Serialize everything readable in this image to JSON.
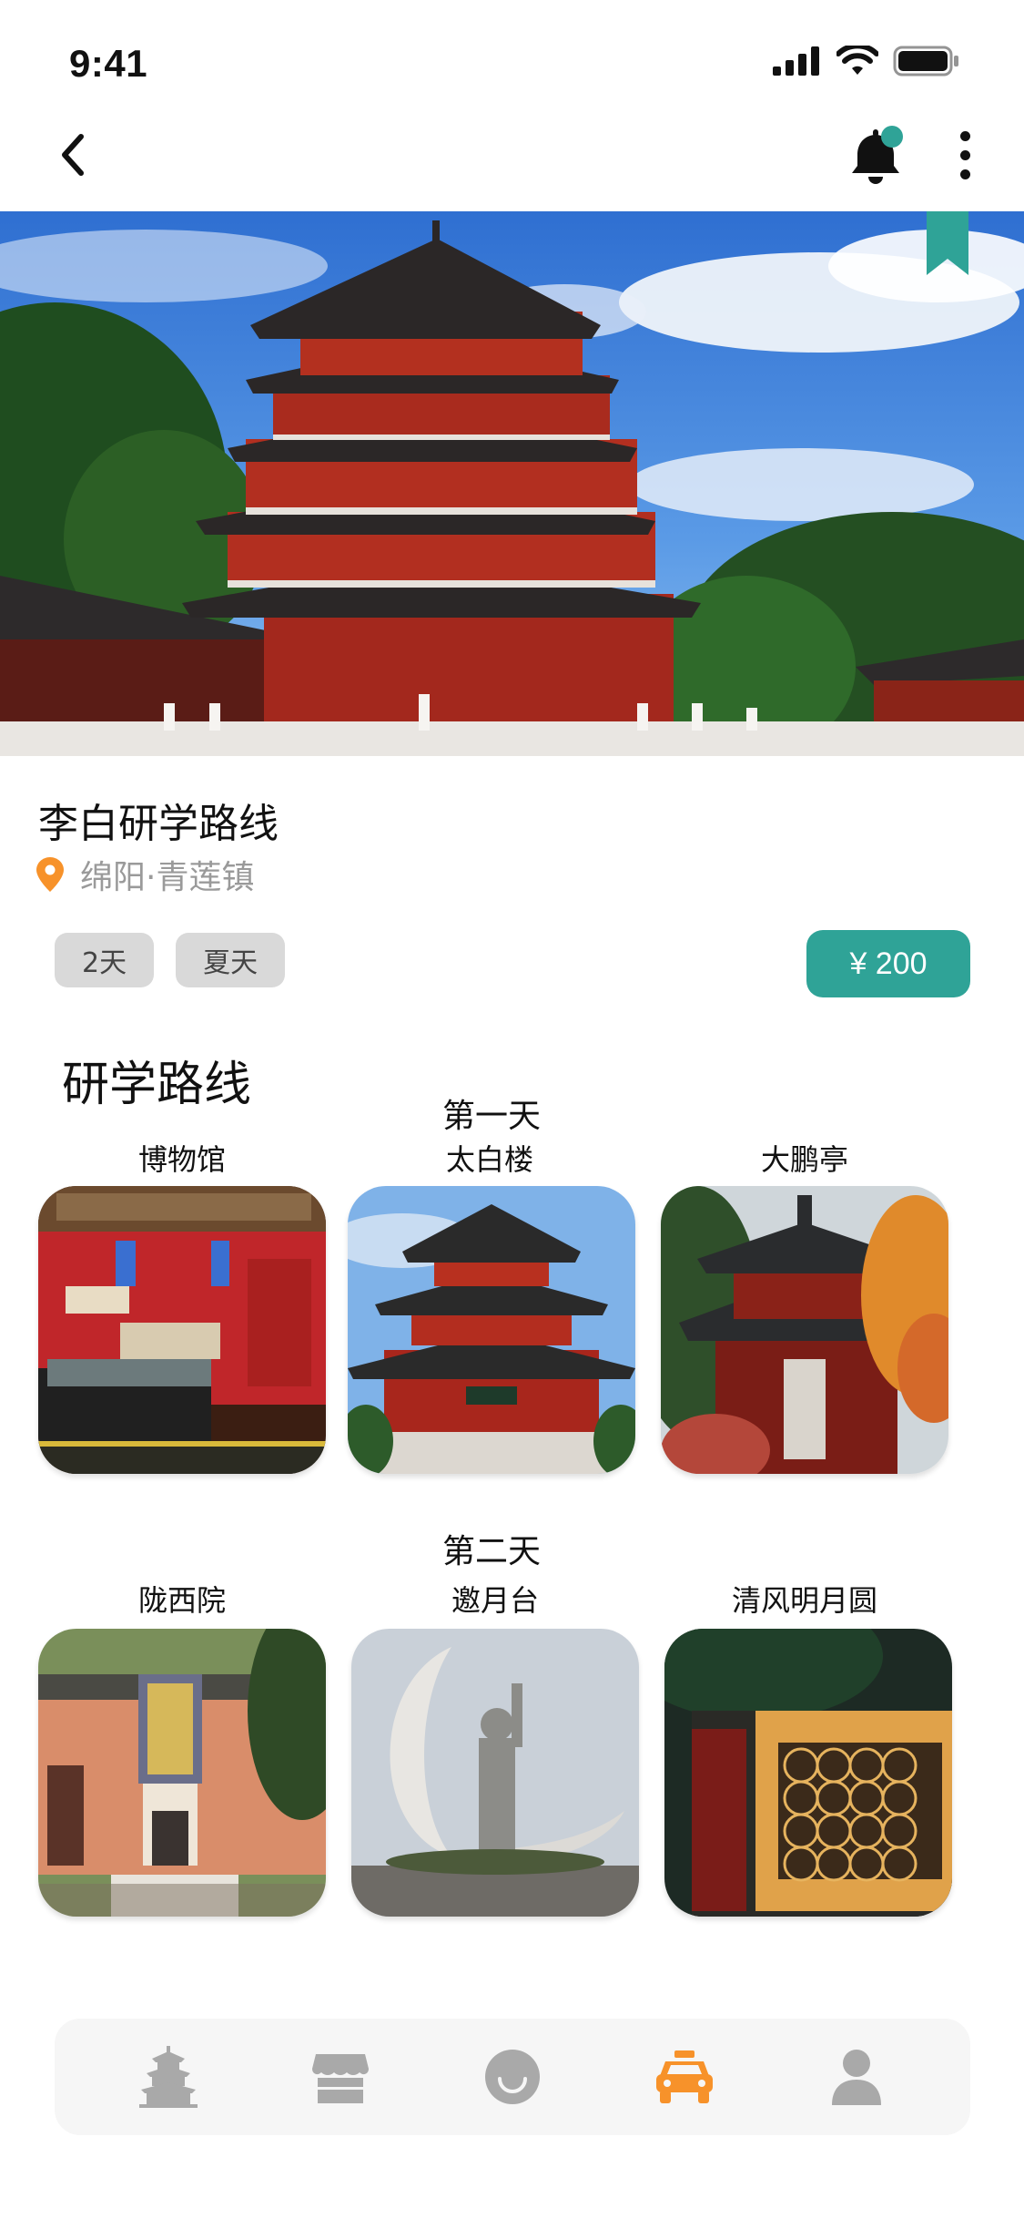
{
  "status_bar": {
    "time": "9:41"
  },
  "header": {
    "back_icon": "chevron-left-icon",
    "bell_icon": "bell-icon",
    "more_icon": "more-vertical-icon",
    "notification_dot_color": "#2fa397"
  },
  "hero": {
    "bookmark_color": "#2fa397"
  },
  "route": {
    "title": "李白研学路线",
    "location": "绵阳·青莲镇",
    "tags": [
      "2天",
      "夏天"
    ],
    "price": "¥ 200"
  },
  "section_title": "研学路线",
  "days": [
    {
      "label": "第一天",
      "spots": [
        "博物馆",
        "太白楼",
        "大鹏亭"
      ]
    },
    {
      "label": "第二天",
      "spots": [
        "陇西院",
        "邀月台",
        "清风明月圆"
      ]
    }
  ],
  "bottom_nav": {
    "items": [
      {
        "icon": "pagoda-icon",
        "active": false
      },
      {
        "icon": "store-icon",
        "active": false
      },
      {
        "icon": "smile-icon",
        "active": false
      },
      {
        "icon": "taxi-icon",
        "active": true
      },
      {
        "icon": "user-icon",
        "active": false
      }
    ],
    "active_color": "#f7922a",
    "inactive_color": "#a9a9a9"
  },
  "colors": {
    "accent": "#2fa397",
    "location_pin": "#f7922a"
  }
}
